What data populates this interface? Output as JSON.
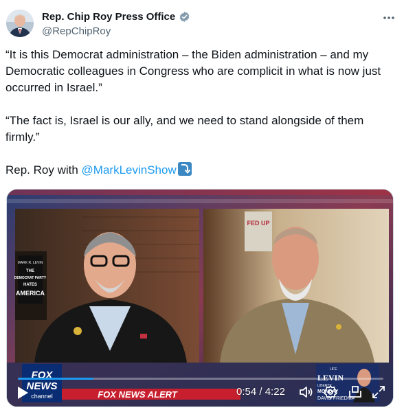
{
  "author": {
    "display_name": "Rep. Chip Roy Press Office",
    "handle": "@RepChipRoy",
    "verified_badge_icon": "verified-badge-icon"
  },
  "tweet": {
    "paragraph_1": "“It is this Democrat administration – the Biden administration – and my Democratic colleagues in Congress who are complicit in what is now just occurred in Israel.”",
    "paragraph_2": "“The fact is, Israel is our ally, and we need to stand alongside of them firmly.”",
    "paragraph_3_prefix": "Rep. Roy with ",
    "mention": "@MarkLevinShow",
    "emoji_icon": "right-arrow-curving-down-icon"
  },
  "video": {
    "fox_news_logo_line1": "FOX",
    "fox_news_logo_line2": "NEWS",
    "fox_news_logo_line3": "channel",
    "ticker_text": "FOX NEWS ALERT",
    "current_time": "0:54",
    "duration": "4:22",
    "time_display": "0:54 / 4:22",
    "progress_fraction": 0.206,
    "book_title_lines": [
      "THE",
      "DEMOCRAT PARTY",
      "HATES",
      "AMERICA"
    ],
    "book_author": "MARK R. LEVIN",
    "sign_text": "FED UP",
    "show_badge_lines": [
      "LIFE",
      "LEVIN",
      "LIBERTY",
      "MONDAY",
      "DAVID FRIEDMAN"
    ],
    "accent_blue": "#1d9bf0"
  },
  "icons": {
    "more": "more-options-icon",
    "play": "play-icon",
    "volume": "volume-icon",
    "settings": "settings-gear-icon",
    "pip": "picture-in-picture-icon",
    "fullscreen": "fullscreen-icon"
  }
}
